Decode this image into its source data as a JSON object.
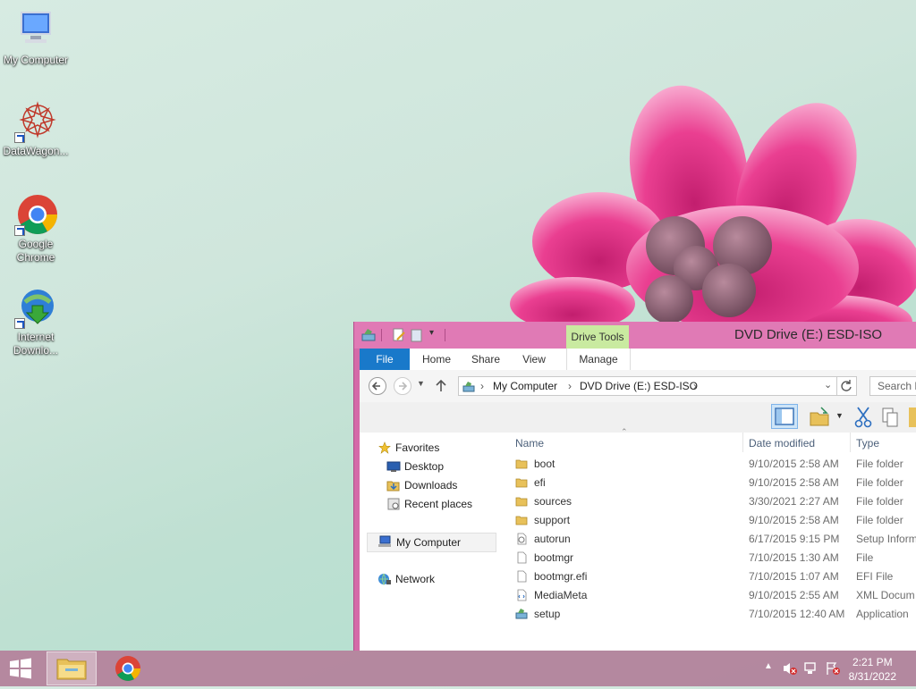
{
  "desktop": {
    "icons": [
      {
        "label": "My Computer"
      },
      {
        "label": "DataWagon..."
      },
      {
        "label": "Google\nChrome"
      },
      {
        "label": "Internet\nDownlo..."
      }
    ]
  },
  "taskbar": {
    "time": "2:21 PM",
    "date": "8/31/2022"
  },
  "explorer": {
    "title": "DVD Drive (E:) ESD-ISO",
    "context_tab": "Drive Tools",
    "tabs": [
      {
        "label": "File"
      },
      {
        "label": "Home"
      },
      {
        "label": "Share"
      },
      {
        "label": "View"
      },
      {
        "label": "Manage"
      }
    ],
    "breadcrumb": [
      "My Computer",
      "DVD Drive (E:) ESD-ISO"
    ],
    "search_placeholder": "Search D",
    "nav": {
      "favorites": "Favorites",
      "desktop": "Desktop",
      "downloads": "Downloads",
      "recent": "Recent places",
      "computer": "My Computer",
      "network": "Network"
    },
    "columns": {
      "name": "Name",
      "date": "Date modified",
      "type": "Type"
    },
    "files": [
      {
        "name": "boot",
        "date": "9/10/2015 2:58 AM",
        "type": "File folder",
        "icon": "folder-icon"
      },
      {
        "name": "efi",
        "date": "9/10/2015 2:58 AM",
        "type": "File folder",
        "icon": "folder-icon"
      },
      {
        "name": "sources",
        "date": "3/30/2021 2:27 AM",
        "type": "File folder",
        "icon": "folder-icon"
      },
      {
        "name": "support",
        "date": "9/10/2015 2:58 AM",
        "type": "File folder",
        "icon": "folder-icon"
      },
      {
        "name": "autorun",
        "date": "6/17/2015 9:15 PM",
        "type": "Setup Inform",
        "icon": "setup-info-icon"
      },
      {
        "name": "bootmgr",
        "date": "7/10/2015 1:30 AM",
        "type": "File",
        "icon": "file-icon"
      },
      {
        "name": "bootmgr.efi",
        "date": "7/10/2015 1:07 AM",
        "type": "EFI File",
        "icon": "file-icon"
      },
      {
        "name": "MediaMeta",
        "date": "9/10/2015 2:55 AM",
        "type": "XML Docum",
        "icon": "xml-file-icon"
      },
      {
        "name": "setup",
        "date": "7/10/2015 12:40 AM",
        "type": "Application",
        "icon": "setup-app-icon"
      }
    ]
  },
  "colors": {
    "window_frame": "#d46aa8",
    "file_tab": "#1979ca",
    "context_tab": "#c9eaa0",
    "folder": "#e8c15a"
  }
}
